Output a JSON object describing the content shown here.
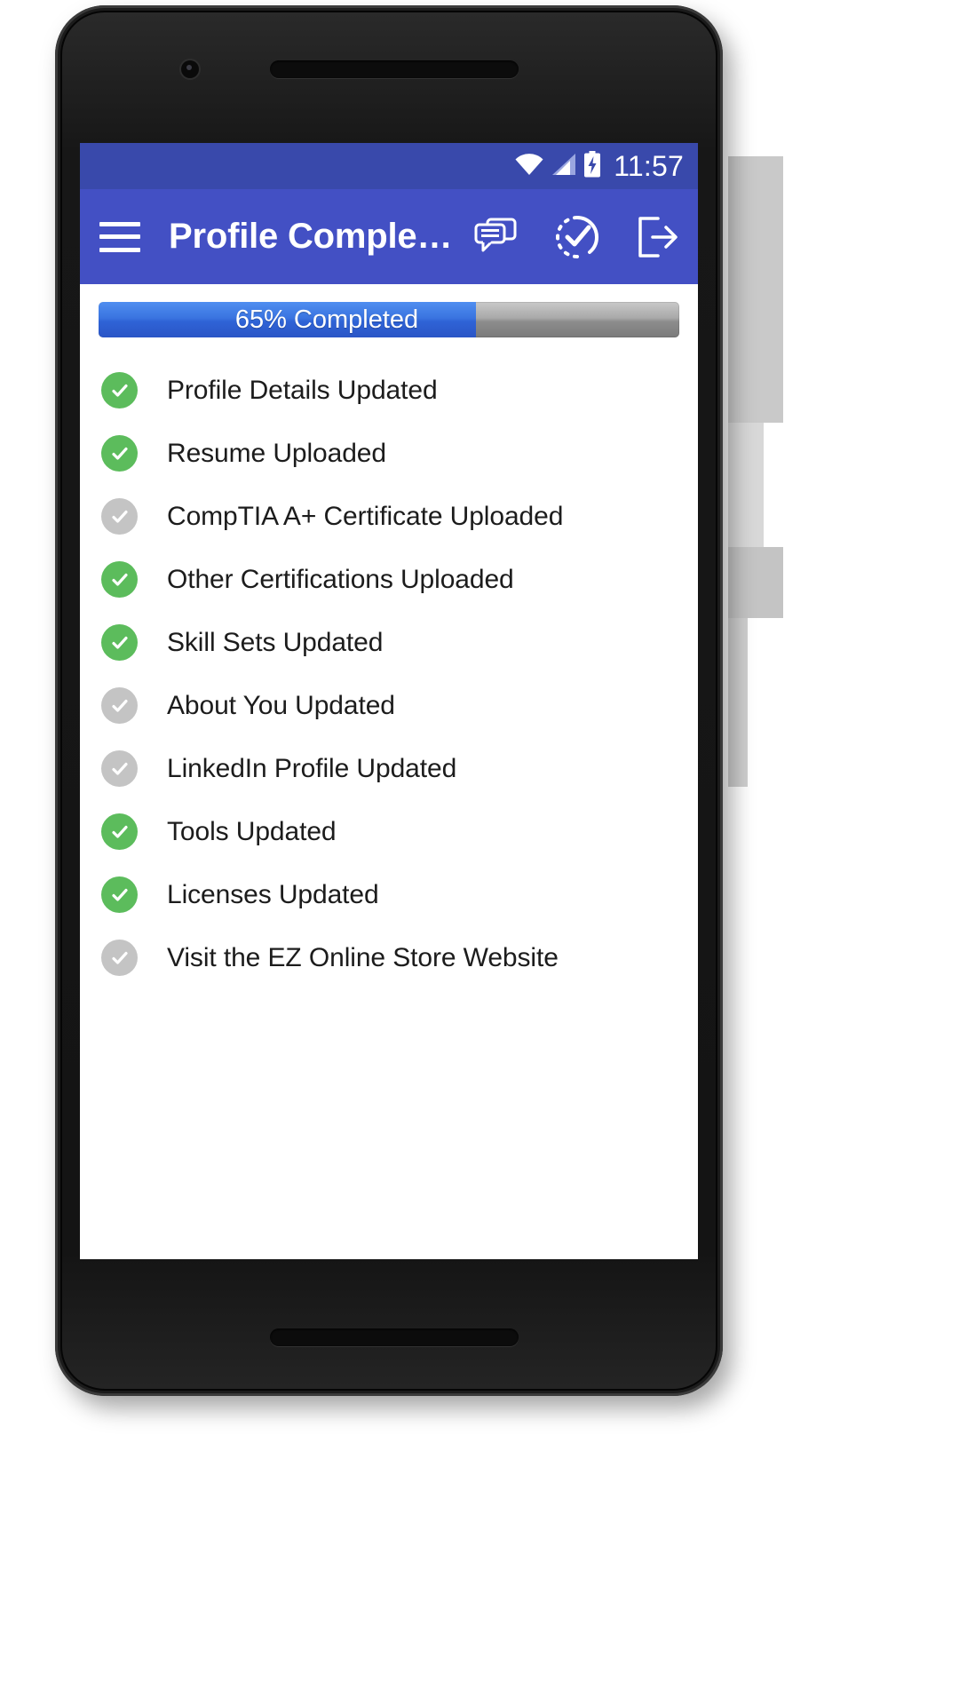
{
  "statusbar": {
    "time": "11:57",
    "icons": [
      "wifi-icon",
      "cellular-signal-icon",
      "battery-charging-icon"
    ]
  },
  "appbar": {
    "menu_icon": "hamburger-menu-icon",
    "title": "Profile Comple…",
    "actions": [
      {
        "name": "messages-icon",
        "label": "Messages"
      },
      {
        "name": "progress-check-icon",
        "label": "Completion"
      },
      {
        "name": "logout-icon",
        "label": "Logout"
      }
    ]
  },
  "progress": {
    "percent": 65,
    "label": "65% Completed",
    "fill_color": "#3a74e0",
    "track_color": "#9a9a9a"
  },
  "colors": {
    "primary": "#4350c4",
    "status_bar": "#3949ab",
    "done": "#5cbc5c",
    "todo": "#c4c4c4"
  },
  "checklist": {
    "items": [
      {
        "label": "Profile Details Updated",
        "done": true
      },
      {
        "label": "Resume Uploaded",
        "done": true
      },
      {
        "label": "CompTIA A+ Certificate Uploaded",
        "done": false
      },
      {
        "label": "Other Certifications Uploaded",
        "done": true
      },
      {
        "label": "Skill Sets Updated",
        "done": true
      },
      {
        "label": "About You Updated",
        "done": false
      },
      {
        "label": "LinkedIn Profile Updated",
        "done": false
      },
      {
        "label": "Tools Updated",
        "done": true
      },
      {
        "label": "Licenses Updated",
        "done": true
      },
      {
        "label": "Visit the EZ Online Store Website",
        "done": false
      }
    ]
  }
}
